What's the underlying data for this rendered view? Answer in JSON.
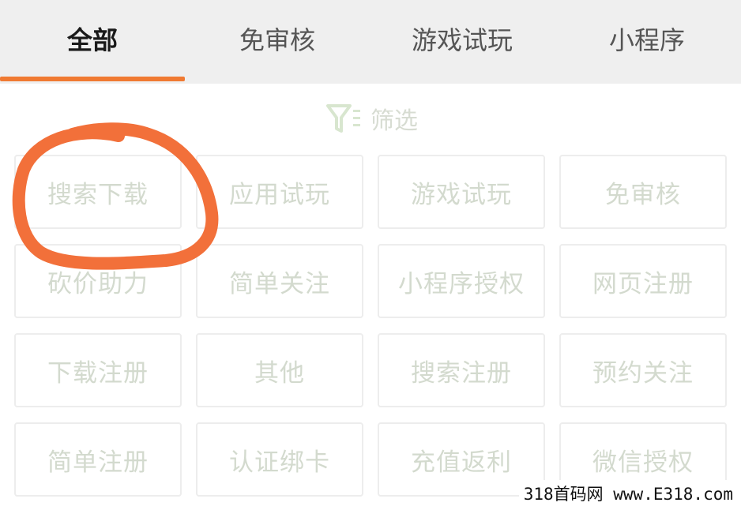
{
  "tabs": [
    {
      "label": "全部",
      "active": true
    },
    {
      "label": "免审核",
      "active": false
    },
    {
      "label": "游戏试玩",
      "active": false
    },
    {
      "label": "小程序",
      "active": false
    }
  ],
  "filter": {
    "label": "筛选",
    "icon": "filter-funnel-icon"
  },
  "categories": [
    "搜索下载",
    "应用试玩",
    "游戏试玩",
    "免审核",
    "砍价助力",
    "简单关注",
    "小程序授权",
    "网页注册",
    "下载注册",
    "其他",
    "搜索注册",
    "预约关注",
    "简单注册",
    "认证绑卡",
    "充值返利",
    "微信授权"
  ],
  "watermark": "318首码网 www.E318.com",
  "colors": {
    "accent": "#f07a32",
    "tab_bar_bg": "#efefef",
    "cell_text": "#d3dace",
    "annotation": "#f2703a"
  }
}
